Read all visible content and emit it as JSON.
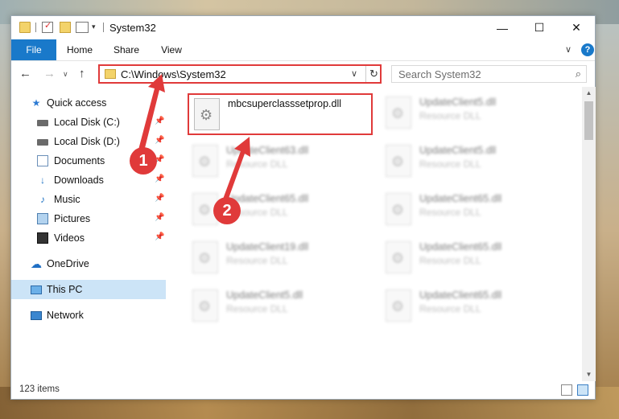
{
  "window": {
    "title": "System32",
    "minimize_glyph": "—",
    "maximize_glyph": "☐",
    "close_glyph": "✕"
  },
  "quick_access_toolbar": {
    "dropdown_glyph": "▾"
  },
  "ribbon": {
    "tabs": [
      "File",
      "Home",
      "Share",
      "View"
    ],
    "collapse_glyph": "∨",
    "help_glyph": "?"
  },
  "navigation": {
    "back_glyph": "←",
    "forward_glyph": "→",
    "recent_glyph": "∨",
    "up_glyph": "↑",
    "address": "C:\\Windows\\System32",
    "address_dropdown_glyph": "∨",
    "refresh_glyph": "↻",
    "search_placeholder": "Search System32",
    "search_glyph": "⌕"
  },
  "sidebar": {
    "items": [
      {
        "label": "Quick access",
        "icon": "star-icon",
        "glyph": "★"
      },
      {
        "label": "Local Disk (C:)",
        "icon": "drive-icon",
        "pinned": true
      },
      {
        "label": "Local Disk (D:)",
        "icon": "drive-icon",
        "pinned": true
      },
      {
        "label": "Documents",
        "icon": "documents-icon",
        "pinned": true
      },
      {
        "label": "Downloads",
        "icon": "download-icon",
        "glyph": "↓",
        "pinned": true
      },
      {
        "label": "Music",
        "icon": "music-icon",
        "glyph": "♪",
        "pinned": true
      },
      {
        "label": "Pictures",
        "icon": "pictures-icon",
        "pinned": true
      },
      {
        "label": "Videos",
        "icon": "videos-icon",
        "pinned": true
      },
      {
        "label": "OneDrive",
        "icon": "onedrive-icon",
        "glyph": "☁"
      },
      {
        "label": "This PC",
        "icon": "computer-icon",
        "selected": true
      },
      {
        "label": "Network",
        "icon": "network-icon"
      }
    ],
    "pin_glyph": "📌"
  },
  "files": [
    {
      "name": "mbcsuperclasssetprop.dll",
      "type": "",
      "highlighted": true
    },
    {
      "name": "UpdateClient5.dll",
      "type": "Resource DLL"
    },
    {
      "name": "UpdateClient63.dll",
      "type": "Resource DLL"
    },
    {
      "name": "UpdateClient5.dll",
      "type": "Resource DLL"
    },
    {
      "name": "UpdateClient65.dll",
      "type": "Resource DLL"
    },
    {
      "name": "UpdateClient65.dll",
      "type": "Resource DLL"
    },
    {
      "name": "UpdateClient19.dll",
      "type": "Resource DLL"
    },
    {
      "name": "UpdateClient65.dll",
      "type": "Resource DLL"
    },
    {
      "name": "UpdateClient5.dll",
      "type": "Resource DLL"
    },
    {
      "name": "UpdateClient65.dll",
      "type": "Resource DLL"
    }
  ],
  "scrollbar": {
    "up_glyph": "▲",
    "down_glyph": "▼"
  },
  "status": {
    "item_count": "123 items"
  },
  "annotations": {
    "step1": "1",
    "step2": "2",
    "color": "#e03a3a"
  },
  "colors": {
    "accent": "#1979ca",
    "selection": "#cce4f7",
    "highlight": "#e03a3a"
  }
}
